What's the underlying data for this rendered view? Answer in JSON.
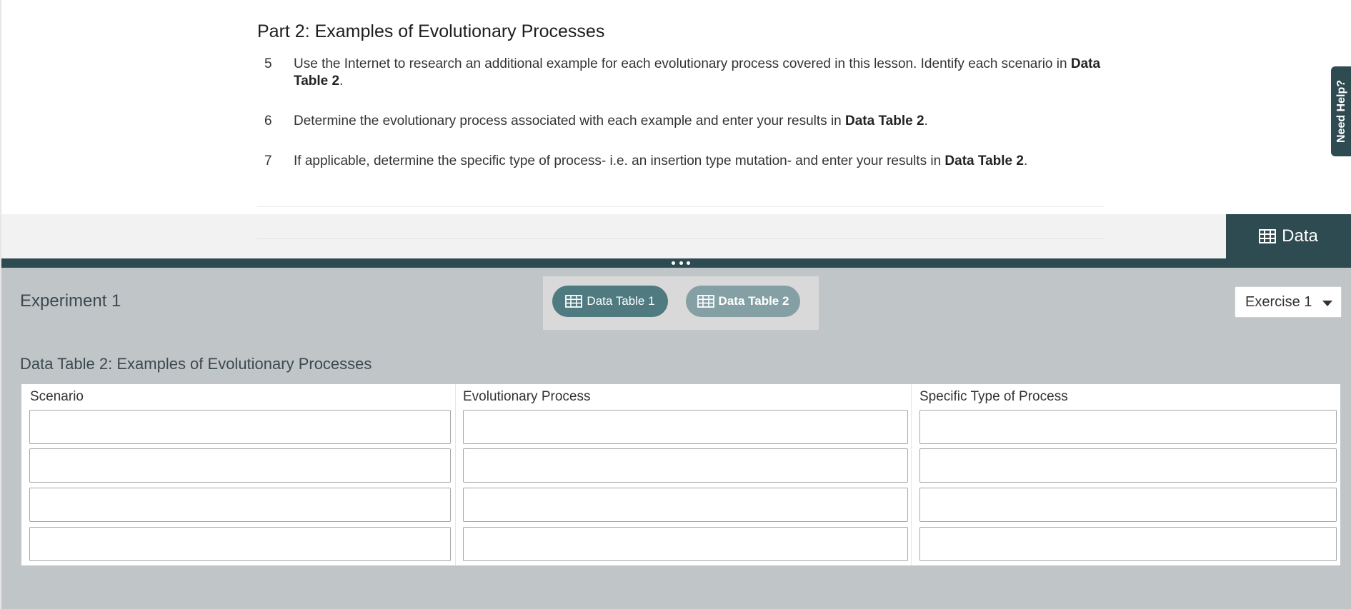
{
  "lesson": {
    "title": "Part 2: Examples of Evolutionary Processes",
    "steps": [
      {
        "num": "5",
        "text_before": "Use the Internet to research an additional example for each evolutionary process covered in this lesson. Identify each scenario in ",
        "bold": "Data Table 2",
        "text_after": "."
      },
      {
        "num": "6",
        "text_before": "Determine the evolutionary process associated with each example and enter your results in ",
        "bold": "Data Table 2",
        "text_after": "."
      },
      {
        "num": "7",
        "text_before": "If applicable, determine the specific type of process- i.e. an insertion type mutation- and enter your results in ",
        "bold": "Data Table 2",
        "text_after": "."
      }
    ]
  },
  "data_tab": {
    "label": "Data",
    "icon": "table-icon"
  },
  "need_help": {
    "label": "Need Help?"
  },
  "panel": {
    "experiment_title": "Experiment 1",
    "buttons": [
      {
        "label": "Data Table 1",
        "icon": "table-icon",
        "active": false
      },
      {
        "label": "Data Table 2",
        "icon": "table-icon",
        "active": true
      }
    ],
    "exercise_select": {
      "value": "Exercise 1"
    },
    "table_title": "Data Table 2: Examples of Evolutionary Processes",
    "table": {
      "columns": [
        "Scenario",
        "Evolutionary Process",
        "Specific Type of Process"
      ],
      "rows": [
        [
          "",
          "",
          ""
        ],
        [
          "",
          "",
          ""
        ],
        [
          "",
          "",
          ""
        ],
        [
          "",
          "",
          ""
        ]
      ]
    }
  },
  "colors": {
    "dark_teal": "#2f4b52",
    "pill_active": "#84a0a4",
    "pill_inactive": "#4e7a80",
    "panel_bg": "#c0c5c8"
  }
}
